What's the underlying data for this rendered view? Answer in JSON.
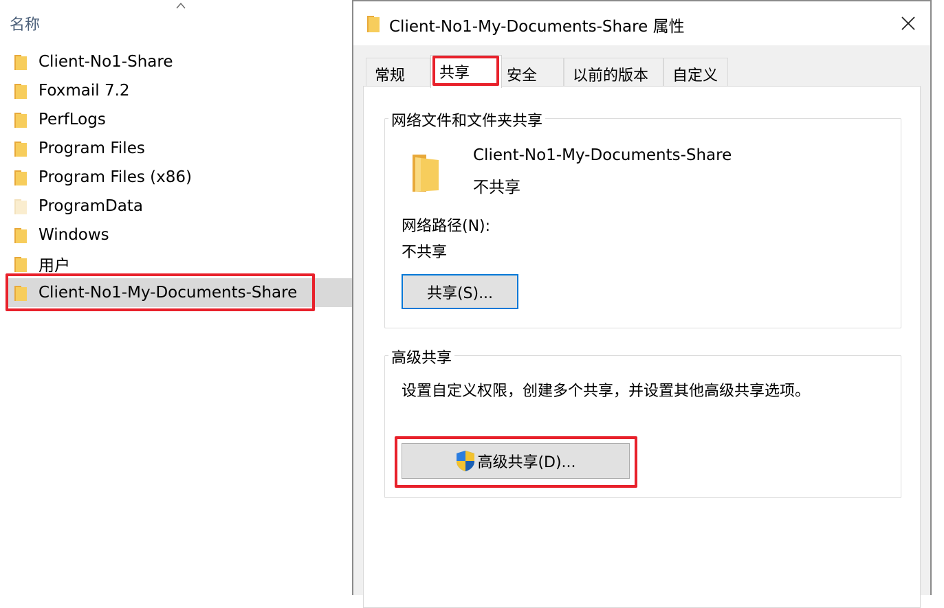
{
  "explorer": {
    "column_header": "名称",
    "items": [
      {
        "name": "Client-No1-Share"
      },
      {
        "name": "Foxmail 7.2"
      },
      {
        "name": "PerfLogs"
      },
      {
        "name": "Program Files"
      },
      {
        "name": "Program Files (x86)"
      },
      {
        "name": "ProgramData"
      },
      {
        "name": "Windows"
      },
      {
        "name": "用户"
      },
      {
        "name": "Client-No1-My-Documents-Share"
      }
    ],
    "selected_index": 8
  },
  "dialog": {
    "title": "Client-No1-My-Documents-Share 属性",
    "tabs": [
      {
        "label": "常规"
      },
      {
        "label": "共享"
      },
      {
        "label": "安全"
      },
      {
        "label": "以前的版本"
      },
      {
        "label": "自定义"
      }
    ],
    "active_tab": "共享",
    "network_share": {
      "group_title": "网络文件和文件夹共享",
      "folder_name": "Client-No1-My-Documents-Share",
      "folder_state": "不共享",
      "path_label": "网络路径(N):",
      "path_value": "不共享",
      "share_button": "共享(S)..."
    },
    "advanced_share": {
      "group_title": "高级共享",
      "description": "设置自定义权限，创建多个共享，并设置其他高级共享选项。",
      "button": "高级共享(D)..."
    }
  },
  "colors": {
    "highlight_outline": "#e8212b",
    "folder_yellow": "#f5c44c",
    "focus_blue": "#0078d7",
    "selected_row": "#d9d9d9"
  }
}
